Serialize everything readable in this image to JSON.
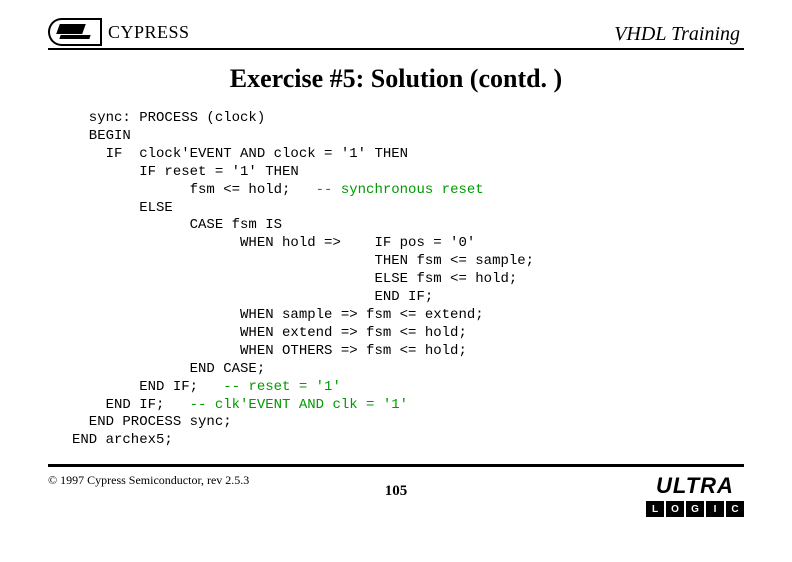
{
  "header": {
    "brand": "CYPRESS",
    "title": "VHDL Training"
  },
  "slide": {
    "title": "Exercise #5: Solution (contd. )"
  },
  "code": {
    "l01": "  sync: PROCESS (clock)",
    "l02": "  BEGIN",
    "l03": "    IF  clock'EVENT AND clock = '1' THEN",
    "l04": "        IF reset = '1' THEN",
    "l05a": "              fsm <= hold;   ",
    "l05c": "-- synchronous reset",
    "l06": "        ELSE",
    "l07": "              CASE fsm IS",
    "l08": "                    WHEN hold =>    IF pos = '0'",
    "l09": "                                    THEN fsm <= sample;",
    "l10": "                                    ELSE fsm <= hold;",
    "l11": "                                    END IF;",
    "l12": "                    WHEN sample => fsm <= extend;",
    "l13": "                    WHEN extend => fsm <= hold;",
    "l14": "                    WHEN OTHERS => fsm <= hold;",
    "l15": "              END CASE;",
    "l16a": "        END IF;   ",
    "l16c": "-- reset = '1'",
    "l17a": "    END IF;   ",
    "l17c": "-- clk'EVENT AND clk = '1'",
    "l18": "  END PROCESS sync;",
    "l19": "END archex5;"
  },
  "footer": {
    "copyright": "© 1997 Cypress Semiconductor, rev 2.5.3",
    "page": "105",
    "ultra": "ULTRA",
    "logic": [
      "L",
      "O",
      "G",
      "I",
      "C"
    ]
  }
}
